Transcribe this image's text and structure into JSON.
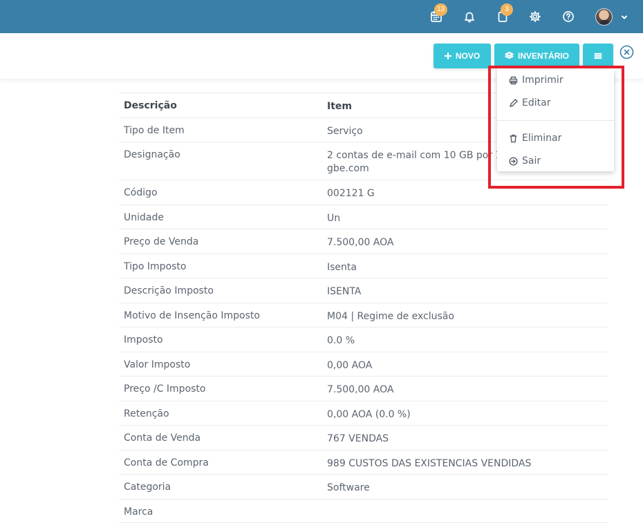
{
  "topbar": {
    "calendar_badge": "13",
    "clipboard_badge": "3",
    "icons": [
      "calendar-icon",
      "bell-icon",
      "clipboard-icon",
      "gear-icon",
      "help-icon",
      "avatar",
      "chevron-down-icon"
    ],
    "color": "#3a7fa8"
  },
  "toolbar": {
    "novo_label": "NOVO",
    "inventario_label": "INVENTÁRIO",
    "button_color": "#3ac6d9"
  },
  "menu": {
    "items": [
      {
        "label": "Imprimir",
        "icon": "printer-icon"
      },
      {
        "label": "Editar",
        "icon": "pencil-icon"
      },
      {
        "label": "Eliminar",
        "icon": "trash-icon"
      },
      {
        "label": "Sair",
        "icon": "exit-icon"
      }
    ]
  },
  "table": {
    "headers": [
      "Descrição",
      "Item"
    ],
    "rows": [
      {
        "label": "Tipo de Item",
        "value": "Serviço"
      },
      {
        "label": "Designação",
        "value": "2 contas de e-mail com 10 GB por 1 a\ngbe.com"
      },
      {
        "label": "Código",
        "value": "002121 G"
      },
      {
        "label": "Unidade",
        "value": "Un"
      },
      {
        "label": "Preço de Venda",
        "value": "7.500,00 AOA"
      },
      {
        "label": "Tipo Imposto",
        "value": "Isenta"
      },
      {
        "label": "Descrição Imposto",
        "value": "ISENTA"
      },
      {
        "label": "Motivo de Insenção Imposto",
        "value": "M04 | Regime de exclusão"
      },
      {
        "label": "Imposto",
        "value": "0.0 %"
      },
      {
        "label": "Valor Imposto",
        "value": "0,00 AOA"
      },
      {
        "label": "Preço /C Imposto",
        "value": "7.500,00 AOA"
      },
      {
        "label": "Retenção",
        "value": "0,00 AOA (0.0 %)"
      },
      {
        "label": "Conta de Venda",
        "value": "767 VENDAS"
      },
      {
        "label": "Conta de Compra",
        "value": "989 CUSTOS DAS EXISTENCIAS VENDIDAS"
      },
      {
        "label": "Categoria",
        "value": "Software"
      },
      {
        "label": "Marca",
        "value": ""
      }
    ]
  },
  "highlight_color": "#e3202c"
}
